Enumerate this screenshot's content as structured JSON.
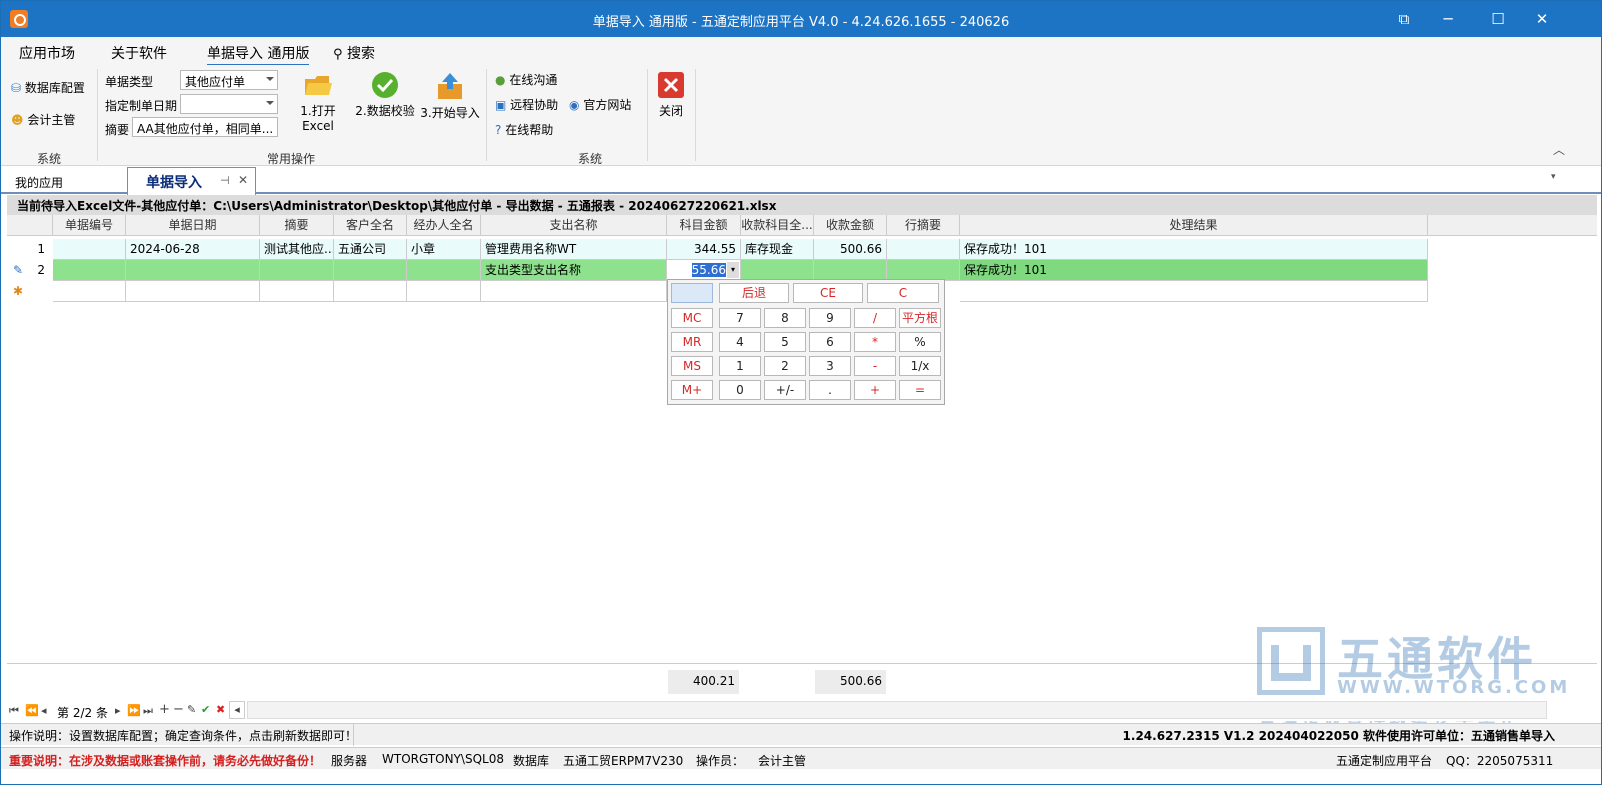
{
  "window": {
    "title": "单据导入 通用版 - 五通定制应用平台 V4.0 - 4.24.626.1655 - 240626"
  },
  "menu": [
    "应用市场",
    "关于软件",
    "单据导入 通用版",
    "搜索"
  ],
  "ribbon": {
    "system_left": {
      "db_config": "数据库配置",
      "accountant": "会计主管",
      "label": "系统"
    },
    "fields": {
      "type_label": "单据类型",
      "type_value": "其他应付单",
      "date_label": "指定制单日期",
      "date_value": "",
      "summary_label": "摘要",
      "summary_value": "AA其他应付单，相同单..."
    },
    "buttons": {
      "open_excel": "1.打开Excel",
      "validate": "2.数据校验",
      "start_import": "3.开始导入"
    },
    "common_label": "常用操作",
    "system_right": {
      "online_chat": "在线沟通",
      "remote_help": "远程协助",
      "website": "官方网站",
      "online_help": "在线帮助",
      "label": "系统"
    },
    "close": "关闭"
  },
  "tabs": {
    "my_apps": "我的应用",
    "active": "单据导入"
  },
  "info": "当前待导入Excel文件-其他应付单：C:\\Users\\Administrator\\Desktop\\其他应付单 - 导出数据 - 五通报表 - 20240627220621.xlsx",
  "grid": {
    "columns": [
      "单据编号",
      "单据日期",
      "摘要",
      "客户全名",
      "经办人全名",
      "支出名称",
      "科目金额",
      "收款科目全...",
      "收款金额",
      "行摘要",
      "处理结果"
    ],
    "rows": [
      {
        "no": "1",
        "cells": [
          "",
          "2024-06-28",
          "测试其他应...",
          "五通公司",
          "小章",
          "管理费用名称WT",
          "344.55",
          "库存现金",
          "500.66",
          "",
          "保存成功！101"
        ]
      },
      {
        "no": "2",
        "cells": [
          "",
          "",
          "",
          "",
          "",
          "支出类型支出名称",
          "55.66",
          "",
          "",
          "",
          "保存成功！101"
        ]
      }
    ],
    "totals": {
      "amount": "400.21",
      "received": "500.66"
    }
  },
  "calculator": {
    "row0": [
      "后退",
      "CE",
      "C"
    ],
    "row1": [
      "MC",
      "7",
      "8",
      "9",
      "/",
      "平方根"
    ],
    "row2": [
      "MR",
      "4",
      "5",
      "6",
      "*",
      "%"
    ],
    "row3": [
      "MS",
      "1",
      "2",
      "3",
      "-",
      "1/x"
    ],
    "row4": [
      "M+",
      "0",
      "+/-",
      ".",
      "+",
      "="
    ]
  },
  "nav": {
    "record": "第 2/2 条"
  },
  "status": {
    "tip": "操作说明：设置数据库配置；确定查询条件，点击刷新数据即可！",
    "version": "1.24.627.2315 V1.2 202404022050 软件使用许可单位：五通销售单导入",
    "warning": "重要说明：在涉及数据或账套操作前，请务必先做好备份！",
    "server_label": "服务器",
    "server": "WTORGTONY\\SQL08",
    "db_label": "数据库",
    "db": "五通工贸ERPM7V230",
    "operator_label": "操作员：",
    "operator": "会计主管",
    "platform": "五通定制应用平台",
    "qq": "QQ：2205075311"
  },
  "watermark": {
    "name": "五通软件",
    "url": "WWW.WTORG.COM",
    "slogan": "专注企业管理数智化十余年"
  },
  "colors": {
    "titlebar": "#1d73c4",
    "row_selected": "#8ee28e",
    "row_alt": "#e9fbfb",
    "calc_red": "#d62828"
  }
}
